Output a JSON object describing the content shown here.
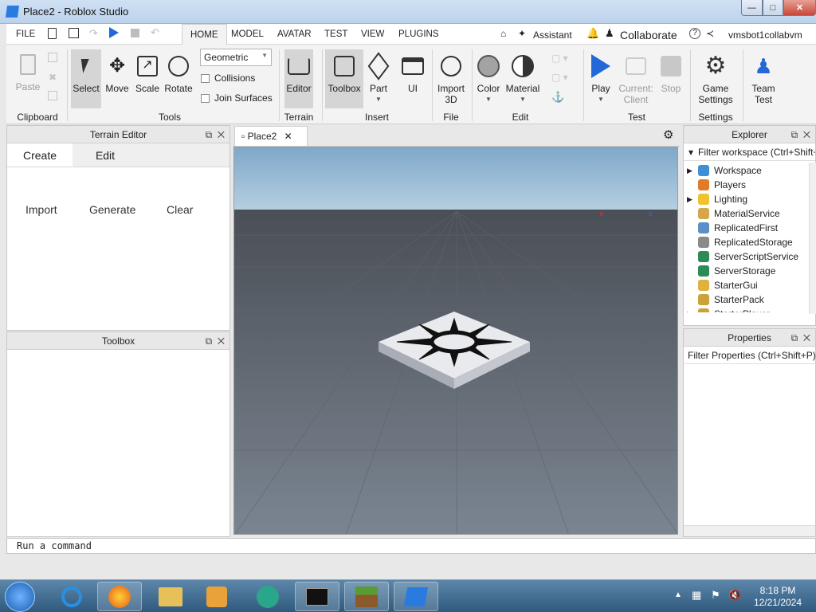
{
  "window": {
    "title": "Place2 - Roblox Studio"
  },
  "menu": {
    "items": [
      "FILE",
      "HOME",
      "MODEL",
      "AVATAR",
      "TEST",
      "VIEW",
      "PLUGINS"
    ],
    "active": "HOME",
    "assistant": "Assistant",
    "collaborate": "Collaborate",
    "user": "vmsbot1collabvm"
  },
  "ribbon": {
    "clipboard": {
      "paste": "Paste",
      "label": "Clipboard"
    },
    "tools": {
      "select": "Select",
      "move": "Move",
      "scale": "Scale",
      "rotate": "Rotate",
      "label": "Tools",
      "mode": "Geometric",
      "collisions": "Collisions",
      "join_surfaces": "Join Surfaces"
    },
    "terrain": {
      "editor": "Editor",
      "label": "Terrain"
    },
    "insert": {
      "toolbox": "Toolbox",
      "part": "Part",
      "ui": "UI",
      "label": "Insert"
    },
    "file": {
      "import3d": "Import 3D",
      "label": "File"
    },
    "edit": {
      "color": "Color",
      "material": "Material",
      "label": "Edit"
    },
    "test": {
      "play": "Play",
      "current_client": "Current: Client",
      "stop": "Stop",
      "label": "Test"
    },
    "settings": {
      "game_settings": "Game Settings",
      "label": "Settings"
    },
    "team_test": {
      "label": "Team Test"
    }
  },
  "terrain_editor": {
    "title": "Terrain Editor",
    "tabs": [
      "Create",
      "Edit"
    ],
    "actions": [
      "Import",
      "Generate",
      "Clear"
    ]
  },
  "toolbox": {
    "title": "Toolbox"
  },
  "viewport": {
    "tab": "Place2"
  },
  "explorer": {
    "title": "Explorer",
    "filter_placeholder": "Filter workspace (Ctrl+Shift+X)",
    "items": [
      {
        "label": "Workspace",
        "expandable": true,
        "color": "#3d8fd8"
      },
      {
        "label": "Players",
        "expandable": false,
        "color": "#e07b2a"
      },
      {
        "label": "Lighting",
        "expandable": true,
        "color": "#f2c22e"
      },
      {
        "label": "MaterialService",
        "expandable": false,
        "color": "#d4a84a"
      },
      {
        "label": "ReplicatedFirst",
        "expandable": false,
        "color": "#5a8fc7"
      },
      {
        "label": "ReplicatedStorage",
        "expandable": false,
        "color": "#8a8a8a"
      },
      {
        "label": "ServerScriptService",
        "expandable": false,
        "color": "#2e8b57"
      },
      {
        "label": "ServerStorage",
        "expandable": false,
        "color": "#2e8b57"
      },
      {
        "label": "StarterGui",
        "expandable": false,
        "color": "#e0b040"
      },
      {
        "label": "StarterPack",
        "expandable": false,
        "color": "#c9a23a"
      },
      {
        "label": "StarterPlayer",
        "expandable": true,
        "color": "#c9a23a"
      }
    ]
  },
  "properties": {
    "title": "Properties",
    "filter_placeholder": "Filter Properties (Ctrl+Shift+P)"
  },
  "command": {
    "placeholder": "Run a command"
  },
  "taskbar": {
    "time": "8:18 PM",
    "date": "12/21/2024"
  }
}
